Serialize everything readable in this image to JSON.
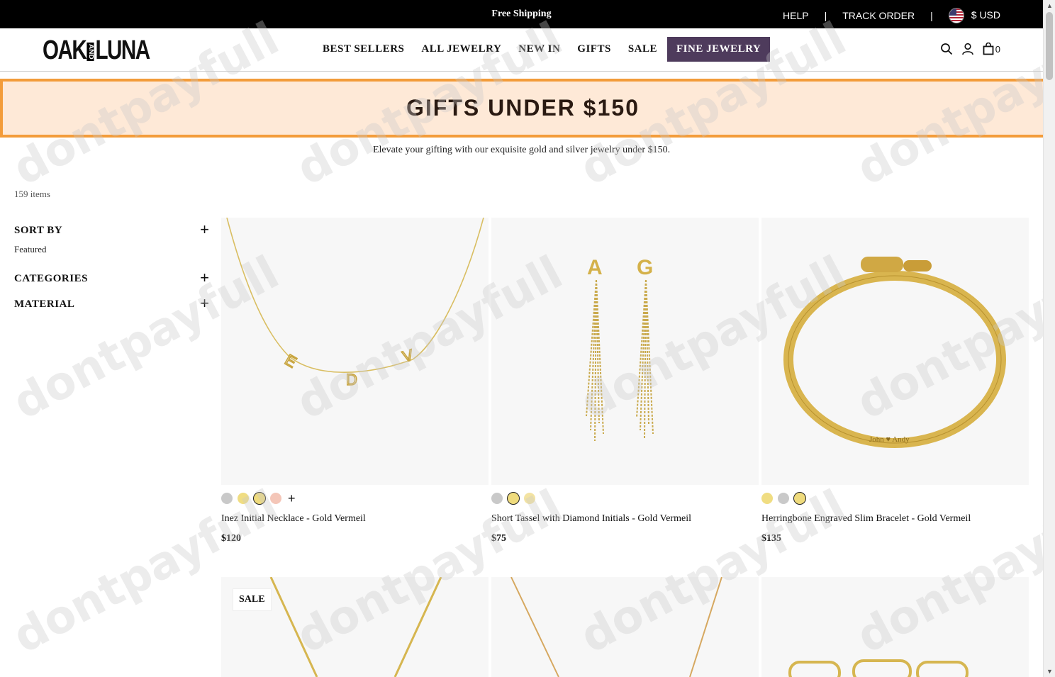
{
  "topbar": {
    "shipping": "Free Shipping",
    "help": "HELP",
    "track": "TRACK ORDER",
    "sep": "|",
    "currency": "$ USD"
  },
  "header": {
    "logo_left": "OAK",
    "logo_mid": "AND",
    "logo_right": "LUNA",
    "nav": [
      "BEST SELLERS",
      "ALL JEWELRY",
      "NEW IN",
      "GIFTS",
      "SALE",
      "FINE JEWELRY"
    ],
    "cart_count": "0"
  },
  "banner": {
    "title": "GIFTS UNDER $150",
    "subtitle": "Elevate your gifting with our exquisite gold and silver jewelry under $150."
  },
  "listing": {
    "count": "159 items"
  },
  "filters": {
    "sort_title": "SORT BY",
    "sort_value": "Featured",
    "categories_title": "CATEGORIES",
    "material_title": "MATERIAL",
    "plus": "+"
  },
  "products": [
    {
      "name": "Inez Initial Necklace - Gold Vermeil",
      "price": "$120",
      "swatches": [
        "#c9c9c9",
        "#f0dd82",
        "#efdb7d",
        "#f4c6b8"
      ],
      "selected": 2,
      "more": "+"
    },
    {
      "name": "Short Tassel with Diamond Initials - Gold Vermeil",
      "price": "$75",
      "swatches": [
        "#c9c9c9",
        "#efdb7d",
        "#f3e3a2"
      ],
      "selected": 1
    },
    {
      "name": "Herringbone Engraved Slim Bracelet - Gold Vermeil",
      "price": "$135",
      "swatches": [
        "#f0dd82",
        "#c9c9c9",
        "#efdb7d"
      ],
      "selected": 2
    },
    {
      "badge": "SALE"
    },
    {},
    {}
  ],
  "bracelet_engraving": "John ♥ Andy",
  "watermark": "dontpayfull",
  "colors": {
    "accent_orange": "#f39c3a",
    "banner_bg": "#fee9d7",
    "fine_jewelry_bg": "#4e3b5c",
    "gold": "#d4b14a"
  }
}
